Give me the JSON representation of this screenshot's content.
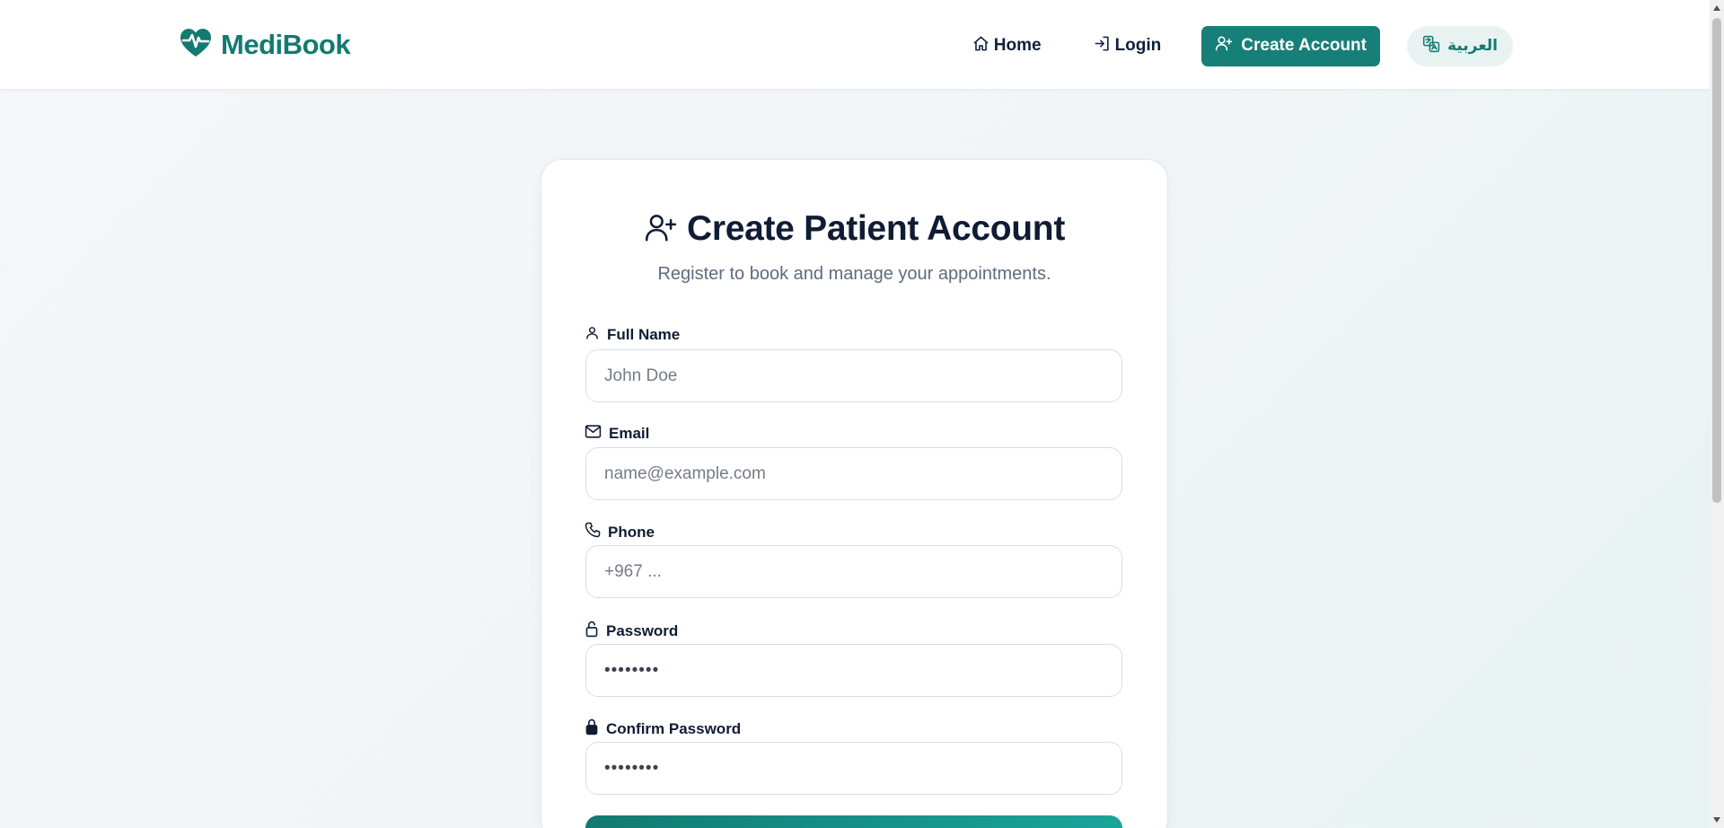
{
  "brand": {
    "name": "MediBook",
    "icon": "heart-pulse-icon",
    "color": "#137a72"
  },
  "nav": {
    "home_label": "Home",
    "login_label": "Login",
    "create_label": "Create Account",
    "language_label": "العربية"
  },
  "form": {
    "title": "Create Patient Account",
    "subtitle": "Register to book and manage your appointments.",
    "fields": [
      {
        "label": "Full Name",
        "icon": "user-icon",
        "placeholder": "John Doe"
      },
      {
        "label": "Email",
        "icon": "mail-icon",
        "placeholder": "name@example.com"
      },
      {
        "label": "Phone",
        "icon": "phone-icon",
        "placeholder": "+967 ..."
      },
      {
        "label": "Password",
        "icon": "lock-open-icon",
        "placeholder": "••••••••"
      },
      {
        "label": "Confirm Password",
        "icon": "lock-icon",
        "placeholder": "••••••••"
      }
    ]
  },
  "colors": {
    "primary": "#167f78",
    "text": "#0f1c33",
    "muted": "#5d6c80"
  }
}
